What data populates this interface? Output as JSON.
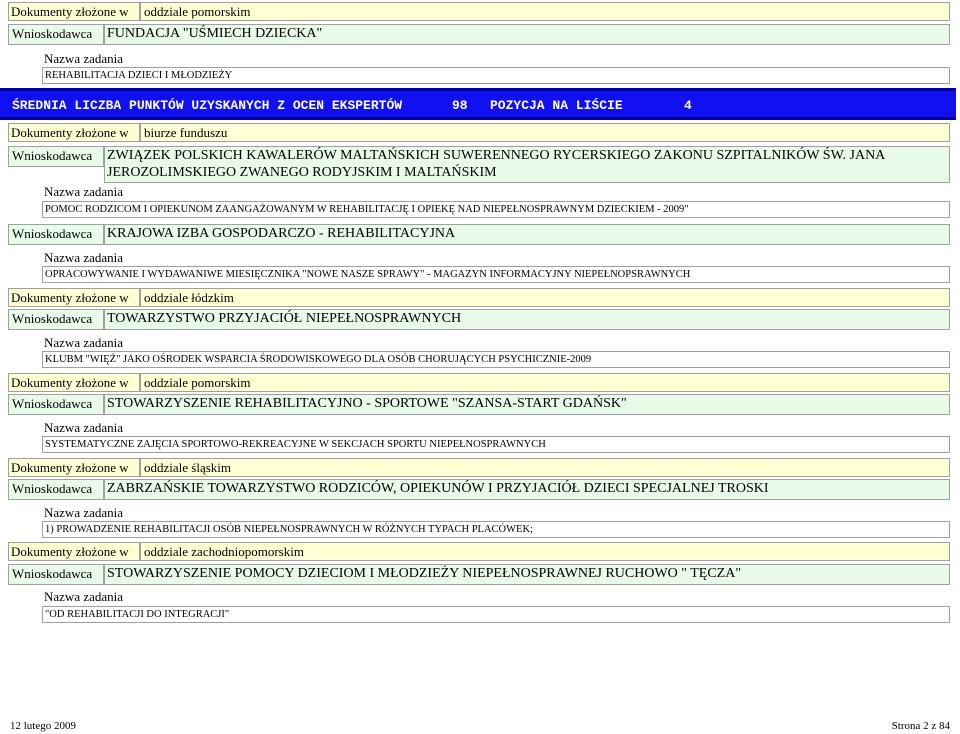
{
  "labels": {
    "dokumenty": "Dokumenty złożone w",
    "wnioskodawca": "Wnioskodawca",
    "nazwa_zadania": "Nazwa zadania"
  },
  "top": {
    "branch": "oddziale pomorskim",
    "applicant": "FUNDACJA \"UŚMIECH DZIECKA\"",
    "task": "REHABILITACJA DZIECI I MŁODZIEŻY"
  },
  "summary_bar": {
    "label": "ŚREDNIA LICZBA PUNKTÓW UZYSKANYCH Z OCEN EKSPERTÓW",
    "score": "98",
    "position_label": "POZYCJA NA LIŚCIE",
    "position": "4"
  },
  "groups": [
    {
      "branch": "biurze funduszu",
      "entries": [
        {
          "applicant": "ZWIĄZEK POLSKICH KAWALERÓW MALTAŃSKICH SUWERENNEGO RYCERSKIEGO ZAKONU SZPITALNIKÓW ŚW. JANA JEROZOLIMSKIEGO ZWANEGO RODYJSKIM I MALTAŃSKIM",
          "task": "POMOC RODZICOM I OPIEKUNOM ZAANGAŻOWANYM W REHABILITACJĘ I OPIEKĘ NAD NIEPEŁNOSPRAWNYM DZIECKIEM - 2009\""
        },
        {
          "applicant": "KRAJOWA IZBA GOSPODARCZO - REHABILITACYJNA",
          "task": "OPRACOWYWANIE I WYDAWANIWE MIESIĘCZNIKA \"NOWE NASZE SPRAWY\" - MAGAZYN INFORMACYJNY NIEPEŁNOPSRAWNYCH"
        }
      ]
    },
    {
      "branch": "oddziale łódzkim",
      "entries": [
        {
          "applicant": "TOWARZYSTWO PRZYJACIÓŁ NIEPEŁNOSPRAWNYCH",
          "task": "KLUBM \"WIĘŹ\" JAKO OŚRODEK WSPARCIA ŚRODOWISKOWEGO DLA OSÓB CHORUJĄCYCH PSYCHICZNIE-2009"
        }
      ]
    },
    {
      "branch": "oddziale pomorskim",
      "entries": [
        {
          "applicant": "STOWARZYSZENIE REHABILITACYJNO - SPORTOWE \"SZANSA-START GDAŃSK\"",
          "task": "SYSTEMATYCZNE ZAJĘCIA SPORTOWO-REKREACYJNE W SEKCJACH SPORTU NIEPEŁNOSPRAWNYCH"
        }
      ]
    },
    {
      "branch": "oddziale śląskim",
      "entries": [
        {
          "applicant": "ZABRZAŃSKIE TOWARZYSTWO RODZICÓW, OPIEKUNÓW I PRZYJACIÓŁ DZIECI SPECJALNEJ TROSKI",
          "task": "1) PROWADZENIE REHABILITACJI OSÓB NIEPEŁNOSPRAWNYCH W RÓŻNYCH TYPACH PLACÓWEK;"
        }
      ]
    },
    {
      "branch": "oddziale zachodniopomorskim",
      "entries": [
        {
          "applicant": "STOWARZYSZENIE POMOCY DZIECIOM I MŁODZIEŻY NIEPEŁNOSPRAWNEJ RUCHOWO \" TĘCZA\"",
          "task": "\"OD REHABILITACJI DO INTEGRACJI\""
        }
      ]
    }
  ],
  "footer": {
    "date": "12 lutego 2009",
    "page": "Strona 2 z 84"
  }
}
